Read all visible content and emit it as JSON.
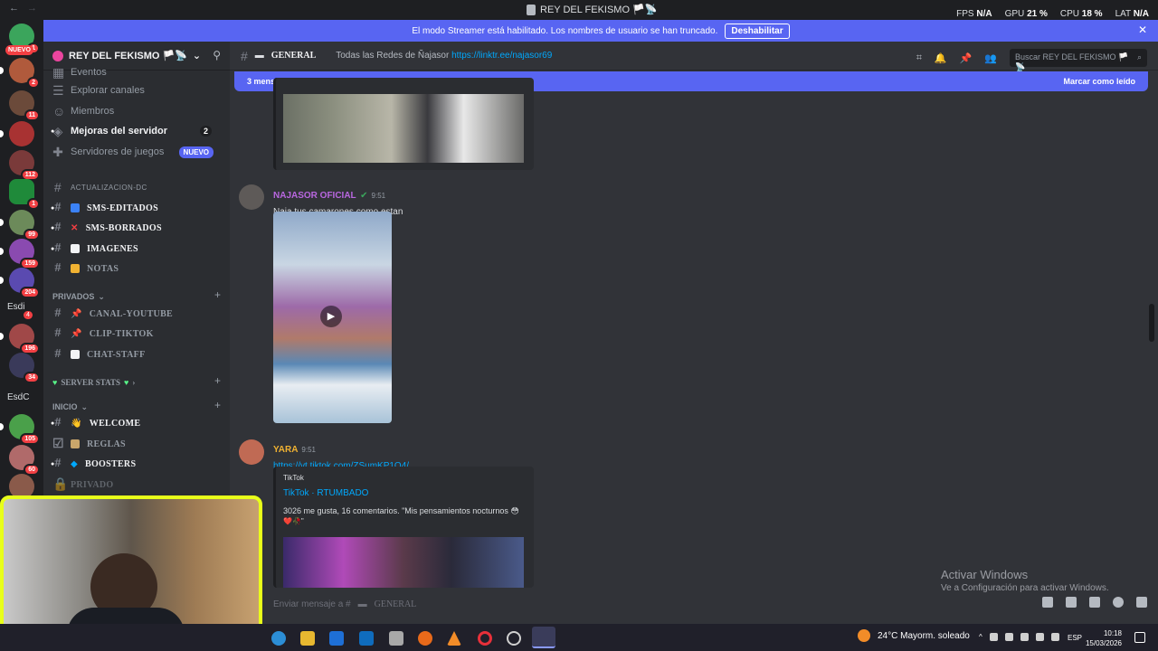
{
  "titlebar": {
    "title": "REY DEL FEKISMO 🏳️📡",
    "fps_label": "FPS",
    "fps": "N/A",
    "gpu_label": "GPU",
    "gpu": "21 %",
    "cpu_label": "CPU",
    "cpu": "18 %",
    "lat_label": "LAT",
    "lat": "N/A"
  },
  "banner": {
    "text": "El modo Streamer está habilitado. Los nombres de usuario se han truncado.",
    "button": "Deshabilitar"
  },
  "guilds": {
    "nuevo": "NUEVO",
    "badges": [
      "1",
      "2",
      "11",
      "112",
      "1",
      "99",
      "159",
      "204",
      "4",
      "196",
      "34",
      "105",
      "60"
    ],
    "text_esdi": "Esdi",
    "text_esdc": "EsdC"
  },
  "server": {
    "name": "REY DEL FEKISMO 🏳️📡"
  },
  "sidebar": {
    "eventos": "Eventos",
    "explorar": "Explorar canales",
    "miembros": "Miembros",
    "mejoras": "Mejoras del servidor",
    "mejoras_count": "2",
    "juegos": "Servidores de juegos",
    "juegos_badge": "NUEVO",
    "cat_actualizacion": "ACTUALIZACION-DC",
    "ch_editados": "SMS-EDITADOS",
    "ch_borrados": "SMS-BORRADOS",
    "ch_imagenes": "IMAGENES",
    "ch_notas": "NOTAS",
    "cat_privados": "PRIVADOS",
    "ch_youtube": "CANAL-YOUTUBE",
    "ch_tiktok": "CLIP-TIKTOK",
    "ch_staff": "CHAT-STAFF",
    "cat_stats": "SERVER STATS",
    "cat_inicio": "INICIO",
    "ch_welcome": "WELCOME",
    "ch_reglas": "REGLAS",
    "ch_boosters": "BOOSTERS",
    "ch_privado": "PRIVADO"
  },
  "channel": {
    "name": "GENERAL",
    "topic_text": "Todas las Redes de Ñajasor",
    "topic_link": "https://linktr.ee/najasor69",
    "search_placeholder": "Buscar REY DEL FEKISMO 🏳️📡"
  },
  "newbar": {
    "text": "3 mensajes nuevos desde las 10:13",
    "action": "Marcar como leído"
  },
  "messages": [
    {
      "user": "NAJASOR OFICIAL",
      "time": "9:51",
      "text": "Naja tus camarones como estan",
      "color": "#b967e0"
    },
    {
      "user": "YARA",
      "time": "9:51",
      "link": "https://vt.tiktok.com/ZSumKP1Q4/",
      "color": "#f0b232"
    }
  ],
  "embed": {
    "provider": "TikTok",
    "title": "TikTok · RTUMBADO",
    "desc": "3026 me gusta, 16 comentarios. \"Mis pensamientos nocturnos 😳",
    "desc2": "❤️🥀\""
  },
  "composer": {
    "placeholder": "Enviar mensaje a #",
    "channel": "GENERAL"
  },
  "windows": {
    "activate": "Activar Windows",
    "activate_sub": "Ve a Configuración para activar Windows."
  },
  "taskbar": {
    "weather": "24°C  Mayorm. soleado",
    "lang": "ESP",
    "time": "10:18",
    "date": "15/03/2026"
  }
}
